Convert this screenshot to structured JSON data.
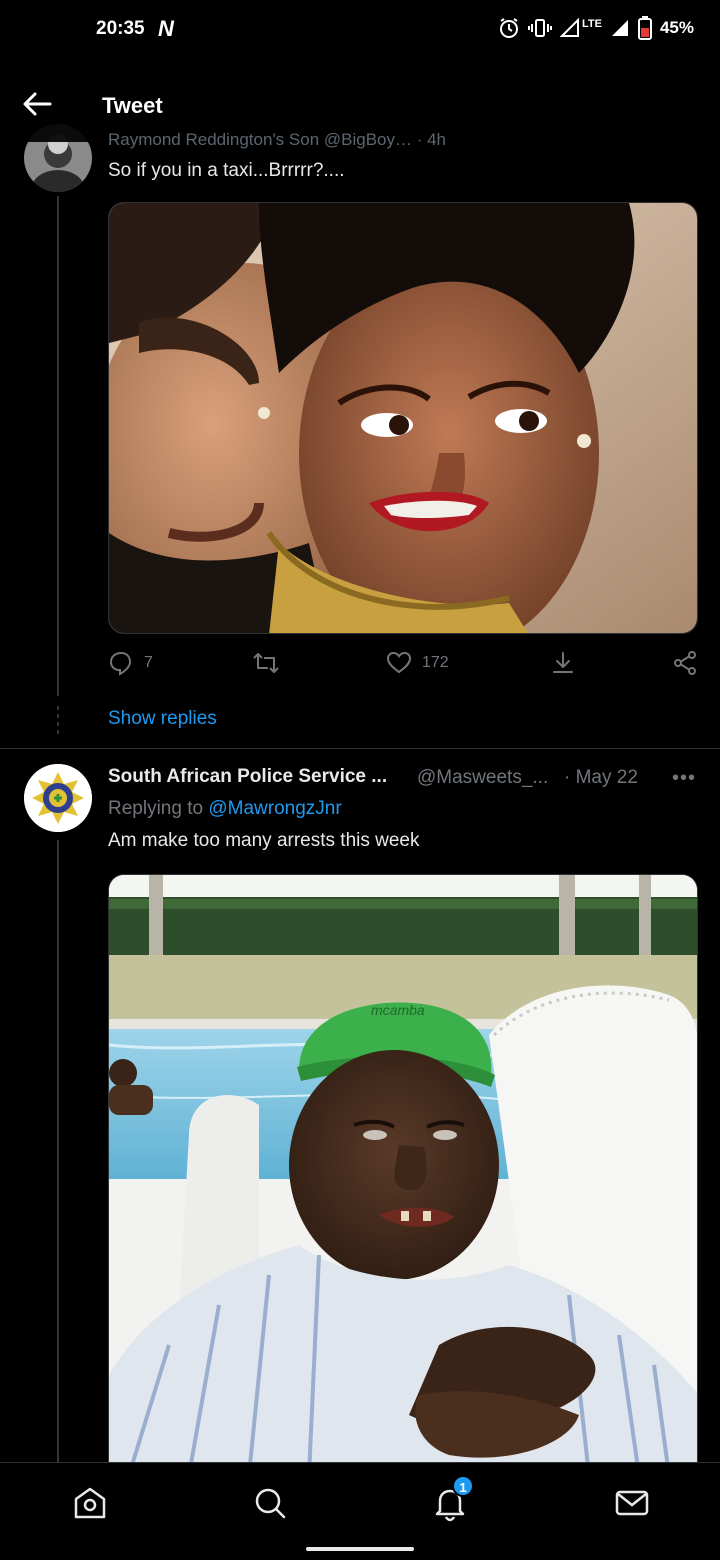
{
  "status_bar": {
    "time": "20:35",
    "network": "LTE",
    "battery": "45%"
  },
  "header": {
    "title": "Tweet",
    "ghost_text": "Raymond Reddington's Son  @BigBoy…  · 4h"
  },
  "tweet1": {
    "text": "So if you in a taxi...Brrrrr?....",
    "reply_count": "7",
    "like_count": "172",
    "show_replies": "Show replies"
  },
  "tweet2": {
    "name": "South African Police Service ...",
    "handle": "@Masweets_...",
    "date": "· May 22",
    "more": "•••",
    "replying_prefix": "Replying to",
    "replying_to": "@MawrongzJnr",
    "text": "Am make too many arrests this week",
    "cap_text": "mcamba"
  },
  "bottom_nav": {
    "notification_count": "1"
  },
  "colors": {
    "accent": "#1d9bf0",
    "muted": "#71767b",
    "text": "#e7e9ea",
    "background": "#000000"
  }
}
